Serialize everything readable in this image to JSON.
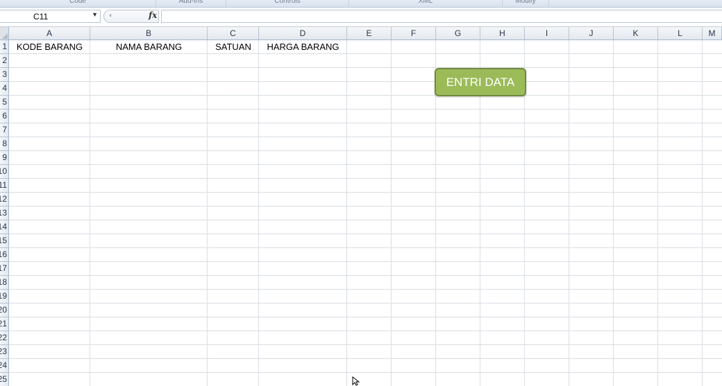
{
  "ribbon": {
    "groups": [
      "Code",
      "Add-Ins",
      "Controls",
      "XML",
      "Modify"
    ]
  },
  "formula_bar": {
    "name_box": "C11",
    "formula": ""
  },
  "columns": [
    "A",
    "B",
    "C",
    "D",
    "E",
    "F",
    "G",
    "H",
    "I",
    "J",
    "K",
    "L",
    "M"
  ],
  "rows": [
    "1",
    "2",
    "3",
    "4",
    "5",
    "6",
    "7",
    "8",
    "9",
    "10",
    "11",
    "12",
    "13",
    "14",
    "15",
    "16",
    "17",
    "18",
    "19",
    "20",
    "21",
    "22",
    "23",
    "24",
    "25"
  ],
  "cells": {
    "A1": "KODE BARANG",
    "B1": "NAMA BARANG",
    "C1": "SATUAN",
    "D1": "HARGA BARANG"
  },
  "button": {
    "label": "ENTRI DATA",
    "fill_color": "#9bbb59",
    "border_color": "#71893f"
  },
  "icons": {
    "name_box_dropdown": "chevron-down-icon",
    "function": "fx-icon",
    "cursor": "mouse-pointer-icon"
  }
}
